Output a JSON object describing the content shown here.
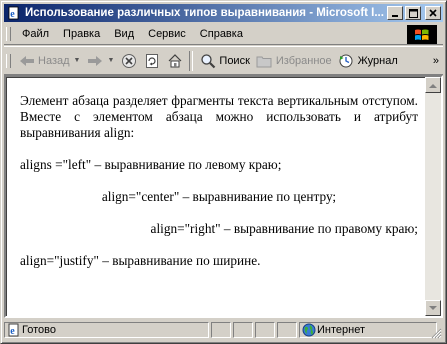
{
  "window": {
    "title": "Использование различных типов выравнивания - Microsoft I...",
    "title_icon": "ie-page-icon"
  },
  "menu": {
    "items": [
      {
        "label": "Файл"
      },
      {
        "label": "Правка"
      },
      {
        "label": "Вид"
      },
      {
        "label": "Сервис"
      },
      {
        "label": "Справка"
      }
    ]
  },
  "toolbar": {
    "back_label": "Назад",
    "search_label": "Поиск",
    "favorites_label": "Избранное",
    "history_label": "Журнал",
    "overflow": "»"
  },
  "content": {
    "paragraphs": [
      {
        "align": "justify",
        "text": "Элемент абзаца разделяет фрагменты текста вертикальным отступом. Вместе с элементом абзаца можно использовать и атрибут выравнивания align:"
      },
      {
        "align": "left",
        "text": "aligns =\"left\" – выравнивание по левому краю;"
      },
      {
        "align": "center",
        "text": "align=\"center\" – выравнивание по центру;"
      },
      {
        "align": "right",
        "text": "align=\"right\" – выравнивание по правому краю;"
      },
      {
        "align": "justify",
        "text": "align=\"justify\" – выравнивание по ширине."
      }
    ]
  },
  "status": {
    "text": "Готово",
    "zone": "Интернет"
  },
  "colors": {
    "titlebar_start": "#0a246a",
    "titlebar_end": "#a6caf0",
    "chrome": "#d4d0c8",
    "content_bg": "#ffffff"
  }
}
